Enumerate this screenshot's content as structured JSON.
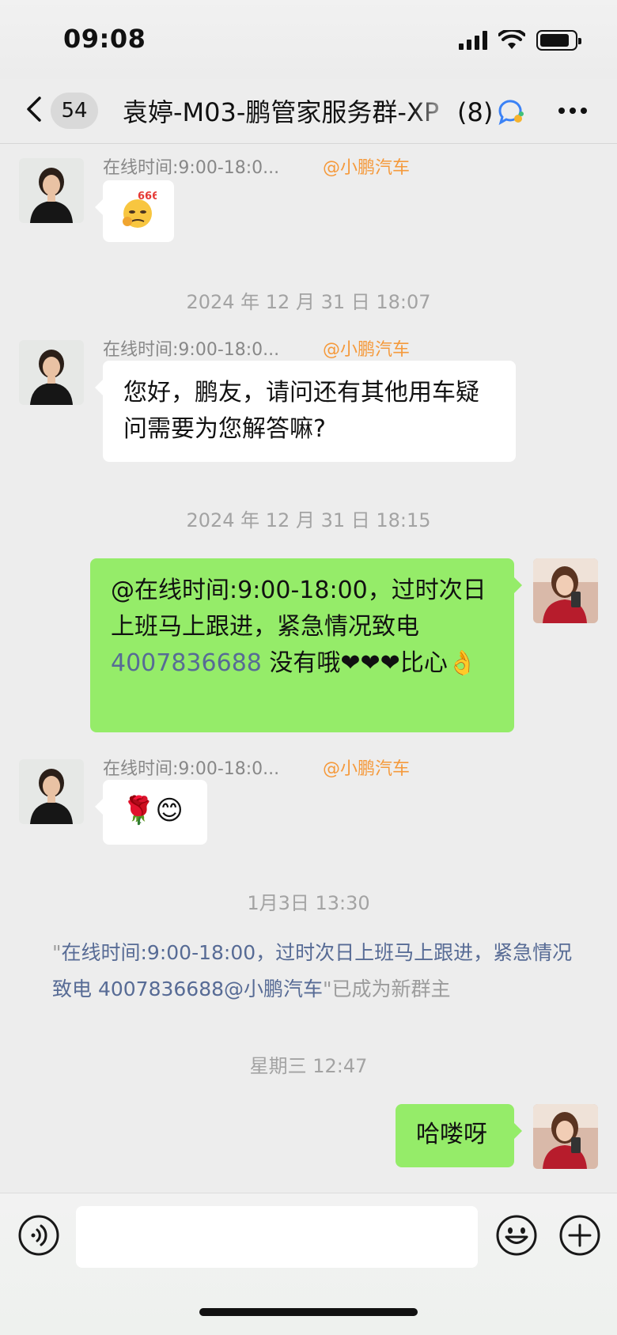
{
  "status_bar": {
    "time": "09:08",
    "battery_level": 0.85
  },
  "nav": {
    "back_label": "<",
    "unread_count": "54",
    "title": "袁婷-M03-鹏管家服务群-XP",
    "member_count": "(8)",
    "group_icon": "group-chat-icon",
    "more_icon": "more-icon"
  },
  "messages": [
    {
      "type": "received",
      "sender": "在线时间:9:00-18:0...",
      "role": "@小鹏汽车",
      "content": "🤔666"
    },
    {
      "type": "timestamp",
      "text": "2024 年 12 月 31 日 18:07"
    },
    {
      "type": "received",
      "sender": "在线时间:9:00-18:0...",
      "role": "@小鹏汽车",
      "content": "您好，鹏友，请问还有其他用车疑问需要为您解答嘛?"
    },
    {
      "type": "timestamp",
      "text": "2024 年 12 月 31 日 18:15"
    },
    {
      "type": "sent",
      "content_part1": "@在线时间:9:00-18:00，过时次日上班马上跟进，紧急情况致电",
      "phone": "4007836688",
      "content_part2": " 没有哦❤❤❤比心👌"
    },
    {
      "type": "received",
      "sender": "在线时间:9:00-18:0...",
      "role": "@小鹏汽车",
      "content": "🌹😊"
    },
    {
      "type": "timestamp",
      "text": "1月3日 13:30"
    },
    {
      "type": "system",
      "quote_open": "\"",
      "name": "在线时间:9:00-18:00，过时次日上班马上跟进，紧急情况致电 4007836688@小鹏汽车",
      "suffix": "\"已成为新群主"
    },
    {
      "type": "timestamp",
      "text": "星期三 12:47"
    },
    {
      "type": "sent",
      "content": "哈喽呀"
    }
  ],
  "input_bar": {
    "voice_icon": "voice-icon",
    "emoji_icon": "emoji-icon",
    "plus_icon": "plus-icon",
    "placeholder": ""
  },
  "colors": {
    "sent_bubble": "#95ec69",
    "received_bubble": "#ffffff",
    "role_tag": "#f59a3c",
    "link": "#576b95",
    "background": "#ededed"
  }
}
